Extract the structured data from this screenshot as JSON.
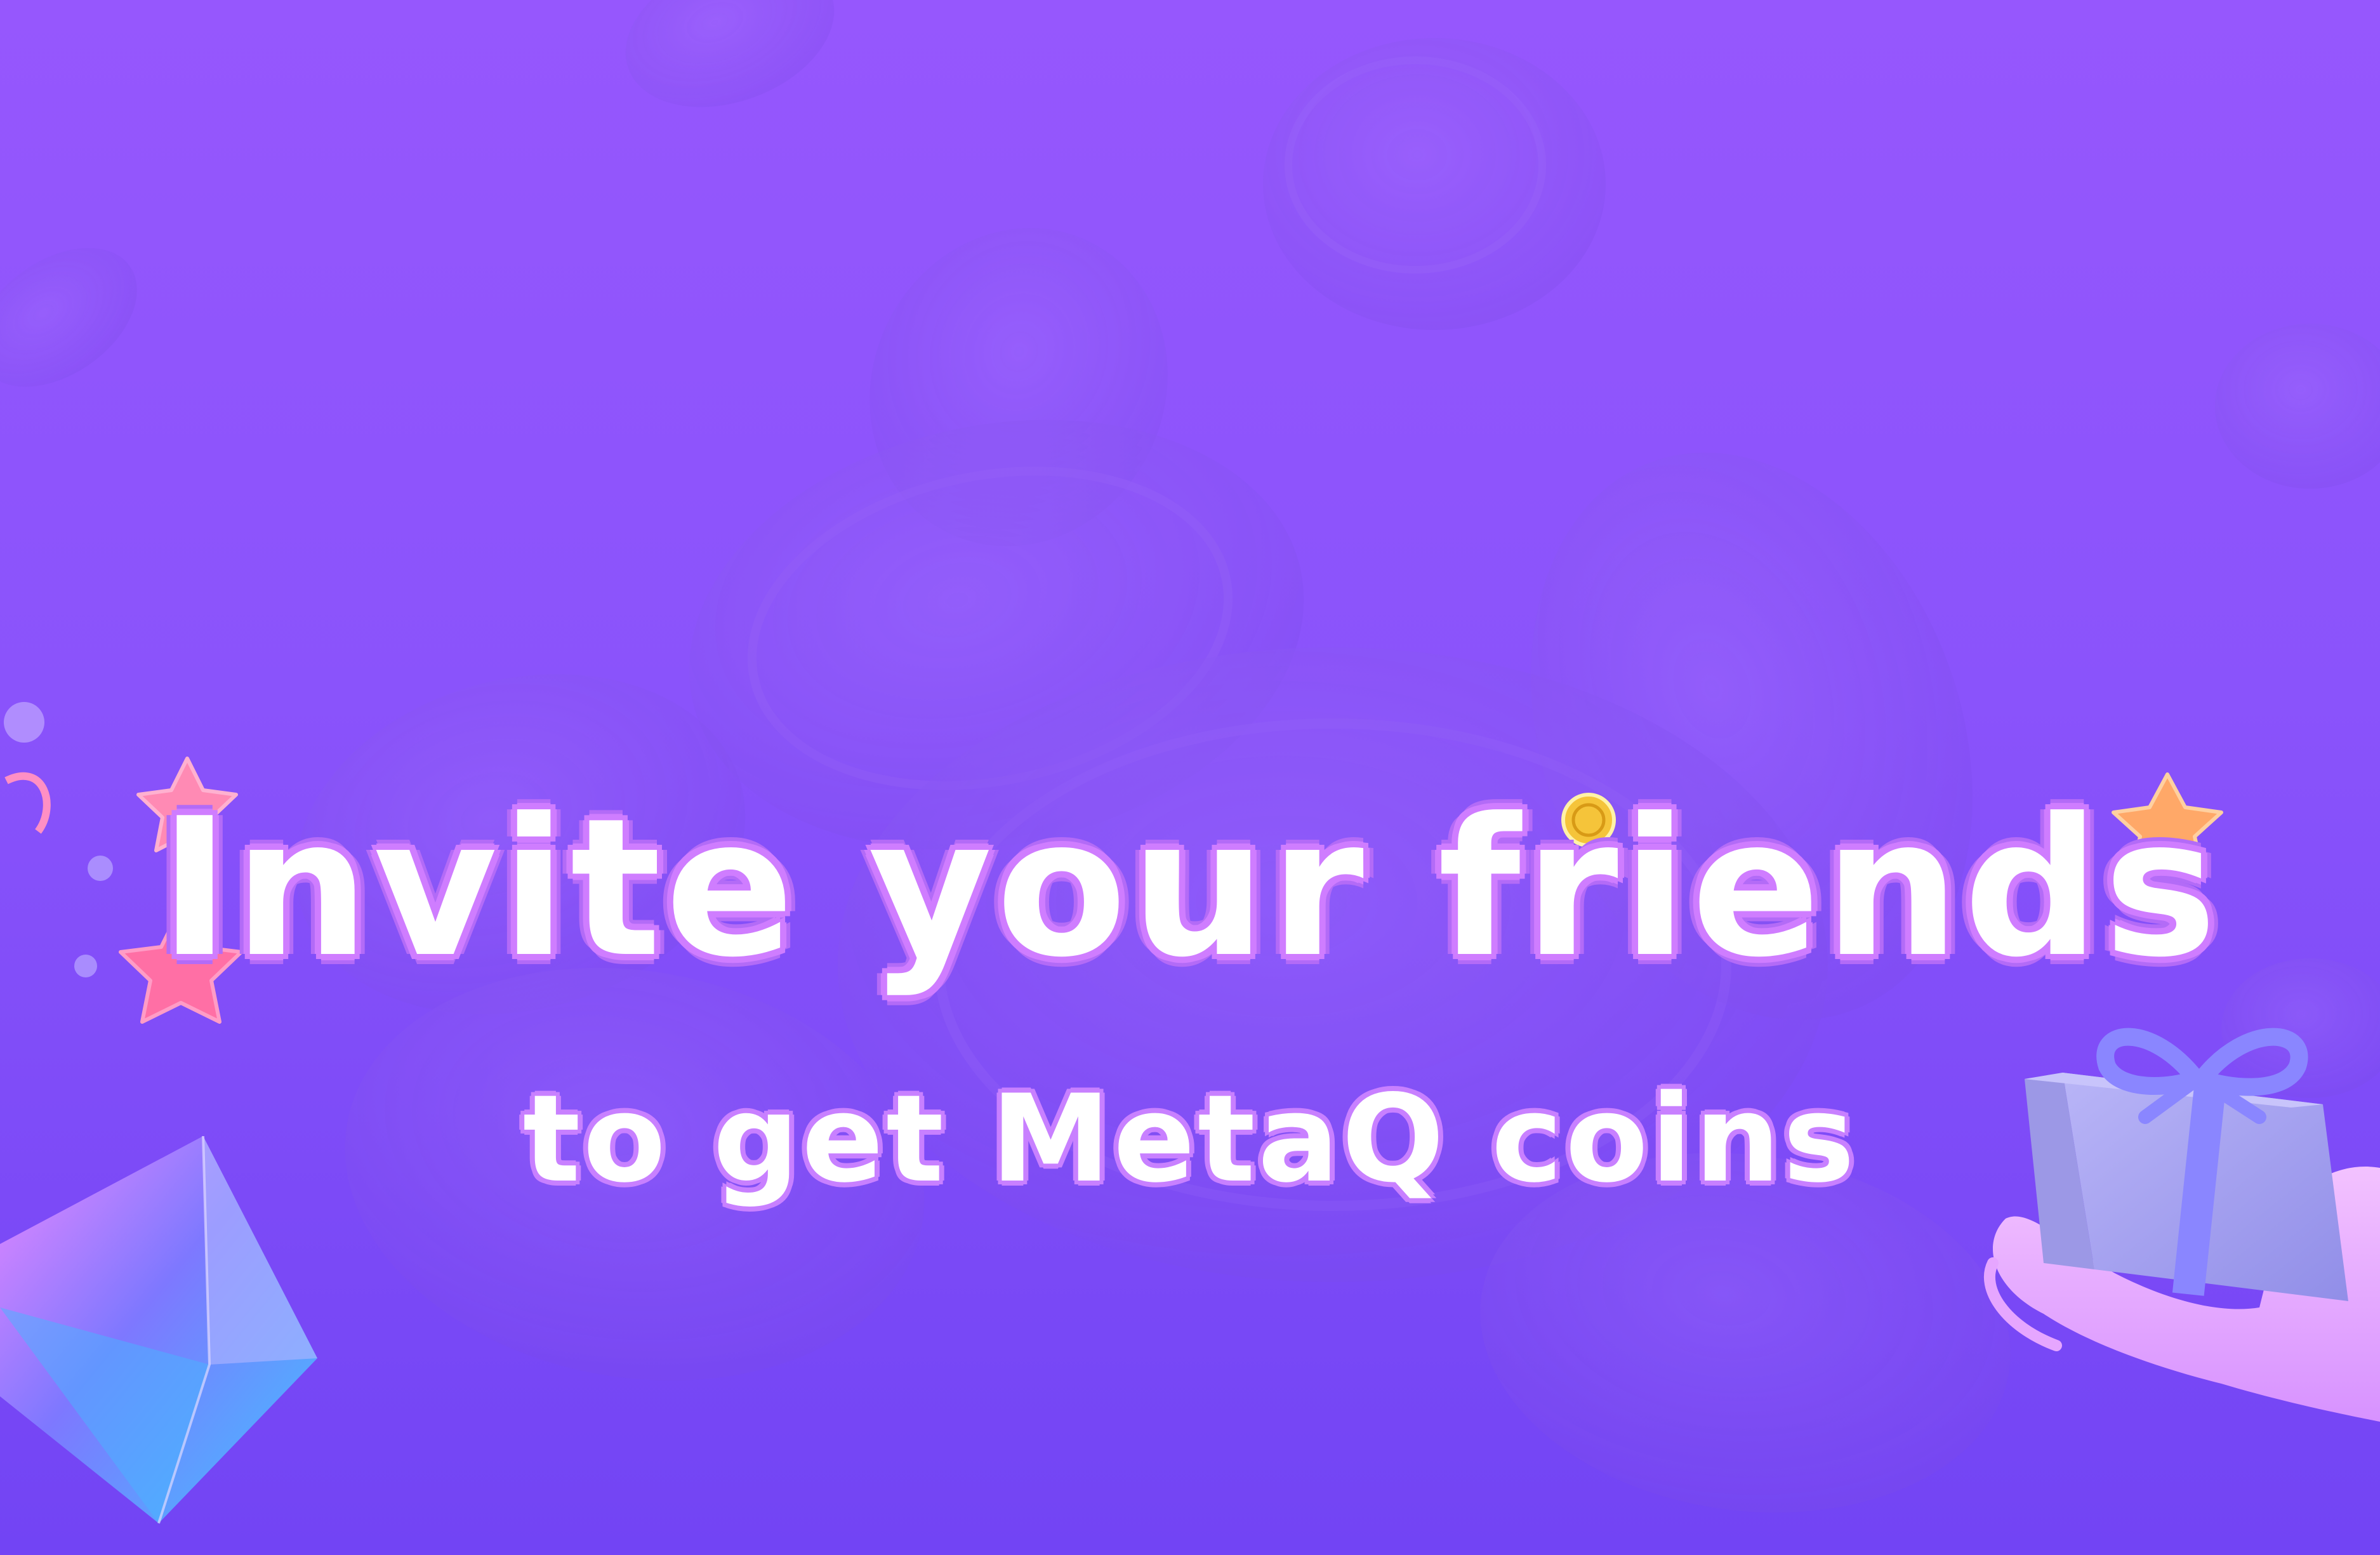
{
  "banner": {
    "headline": "Invite your friends",
    "subline": "to get MetaQ coins"
  },
  "colors": {
    "background_top": "#9657fd",
    "background_mid": "#8a53fb",
    "background_bottom": "#7244f4",
    "text": "#ffffff",
    "text_outline": "#cf7dff",
    "coin_gold": "#f5c43a",
    "star_pink": "#ff7fb0",
    "star_orange": "#ffa868",
    "gift_box": "#a9a6f0",
    "gift_ribbon": "#8a86ff"
  },
  "icons": [
    "coin-icon",
    "star-icon",
    "gift-box-icon",
    "crystal-gem-icon",
    "hand-icon",
    "bubble-icon"
  ]
}
